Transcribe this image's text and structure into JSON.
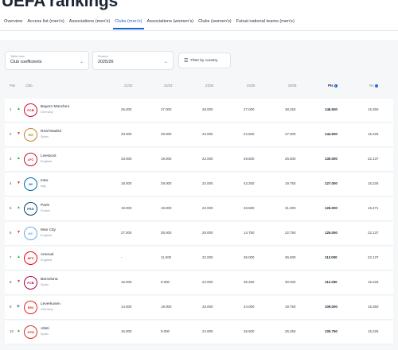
{
  "page": {
    "title": "UEFA rankings"
  },
  "tabs": [
    {
      "label": "Overview",
      "active": false
    },
    {
      "label": "Access list (men's)",
      "active": false
    },
    {
      "label": "Associations (men's)",
      "active": false
    },
    {
      "label": "Clubs (men's)",
      "active": true
    },
    {
      "label": "Associations (women's)",
      "active": false
    },
    {
      "label": "Clubs (women's)",
      "active": false
    },
    {
      "label": "Futsal national teams (men's)",
      "active": false
    }
  ],
  "filters": {
    "table_view": {
      "label": "Table view",
      "value": "Club coefficients"
    },
    "season": {
      "label": "Season",
      "value": "2025/26"
    },
    "country_button": "Filter by country"
  },
  "table": {
    "headers": {
      "pos": "Pos",
      "club": "Club",
      "s1": "21/22",
      "s2": "22/23",
      "s3": "23/24",
      "s4": "24/25",
      "s5": "25/26",
      "pts": "Pts",
      "na": "NA"
    },
    "rows": [
      {
        "pos": "1",
        "trend": "up",
        "crest": "FCB",
        "crest_color": "#dc052d",
        "club": "Bayern München",
        "country": "Germany",
        "s1": "26.000",
        "s2": "27.000",
        "s3": "28.000",
        "s4": "27.000",
        "s5": "38.250",
        "pts": "146.500",
        "na": "15.350"
      },
      {
        "pos": "2",
        "trend": "down",
        "crest": "RM",
        "crest_color": "#b88a2c",
        "club": "Real Madrid",
        "country": "Spain",
        "s1": "33.000",
        "s2": "29.000",
        "s3": "34.000",
        "s4": "24.500",
        "s5": "27.000",
        "pts": "144.500",
        "na": "15.226"
      },
      {
        "pos": "3",
        "trend": "up",
        "crest": "LFC",
        "crest_color": "#c8102e",
        "club": "Liverpool",
        "country": "England",
        "s1": "33.000",
        "s2": "19.000",
        "s3": "22.000",
        "s4": "29.500",
        "s5": "26.500",
        "pts": "130.000",
        "na": "22.137"
      },
      {
        "pos": "4",
        "trend": "down",
        "crest": "IM",
        "crest_color": "#0068a8",
        "club": "Inter",
        "country": "Italy",
        "s1": "18.000",
        "s2": "29.000",
        "s3": "22.000",
        "s4": "43.250",
        "s5": "19.750",
        "pts": "127.000",
        "na": "15.226"
      },
      {
        "pos": "5",
        "trend": "up",
        "crest": "PSG",
        "crest_color": "#004170",
        "club": "Paris",
        "country": "France",
        "s1": "19.000",
        "s2": "19.000",
        "s3": "22.000",
        "s4": "33.500",
        "s5": "31.000",
        "pts": "126.000",
        "na": "16.471"
      },
      {
        "pos": "6",
        "trend": "down",
        "crest": "MC",
        "crest_color": "#6cabdd",
        "club": "Man City",
        "country": "England",
        "s1": "27.000",
        "s2": "35.000",
        "s3": "28.000",
        "s4": "14.750",
        "s5": "22.750",
        "pts": "125.000",
        "na": "22.137"
      },
      {
        "pos": "7",
        "trend": "up",
        "crest": "AFC",
        "crest_color": "#ef0107",
        "club": "Arsenal",
        "country": "England",
        "s1": "-",
        "s2": "11.000",
        "s3": "22.000",
        "s4": "36.000",
        "s5": "36.500",
        "pts": "113.000",
        "na": "22.137"
      },
      {
        "pos": "8",
        "trend": "down",
        "crest": "FCB",
        "crest_color": "#a50044",
        "club": "Barcelona",
        "country": "Spain",
        "s1": "15.000",
        "s2": "9.000",
        "s3": "22.000",
        "s4": "36.250",
        "s5": "30.000",
        "pts": "112.250",
        "na": "15.226"
      },
      {
        "pos": "9",
        "trend": "same",
        "crest": "B04",
        "crest_color": "#e32221",
        "club": "Leverkusen",
        "country": "Germany",
        "s1": "14.000",
        "s2": "19.000",
        "s3": "33.000",
        "s4": "24.000",
        "s5": "19.750",
        "pts": "109.000",
        "na": "15.350"
      },
      {
        "pos": "10",
        "trend": "up",
        "crest": "ATM",
        "crest_color": "#cb3524",
        "club": "Atleti",
        "country": "Spain",
        "s1": "15.000",
        "s2": "9.000",
        "s3": "24.000",
        "s4": "26.500",
        "s5": "26.250",
        "pts": "100.750",
        "na": "15.226"
      }
    ]
  },
  "colors": {
    "accent": "#1d5fd6",
    "trend_up": "#2fa84f",
    "trend_down": "#d0342c",
    "trend_same": "#8b95a3"
  }
}
